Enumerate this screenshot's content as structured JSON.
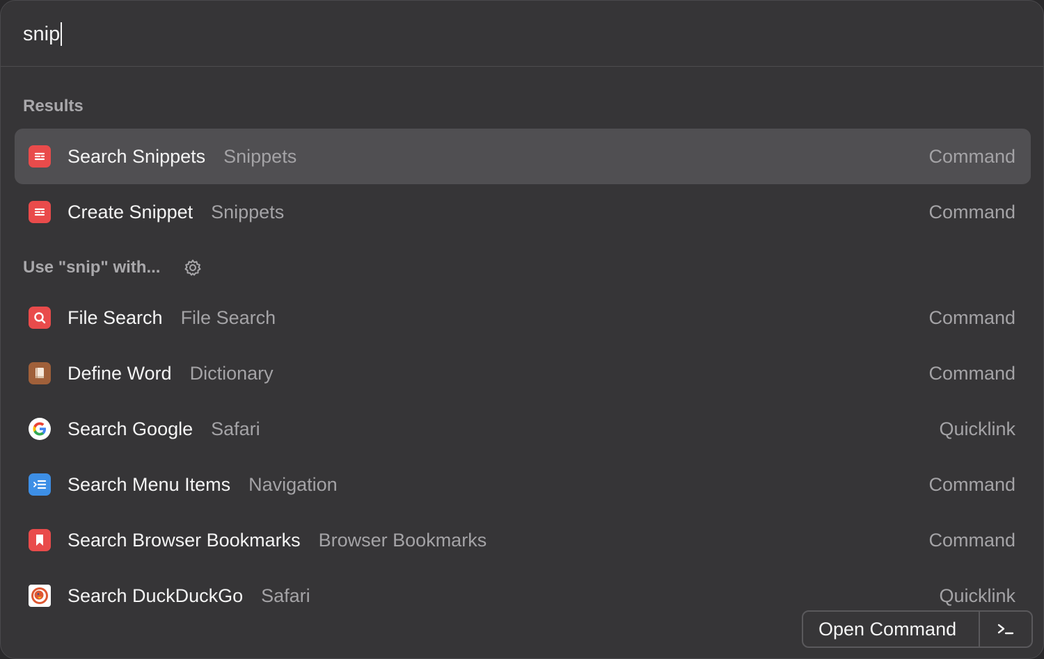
{
  "search": {
    "query": "snip"
  },
  "sections": {
    "results_header": "Results",
    "fallback_header": "Use \"snip\" with..."
  },
  "results": [
    {
      "title": "Search Snippets",
      "subtitle": "Snippets",
      "kind": "Command",
      "icon": "snippets-icon",
      "selected": true
    },
    {
      "title": "Create Snippet",
      "subtitle": "Snippets",
      "kind": "Command",
      "icon": "snippets-icon",
      "selected": false
    }
  ],
  "fallbacks": [
    {
      "title": "File Search",
      "subtitle": "File Search",
      "kind": "Command",
      "icon": "file-search-icon"
    },
    {
      "title": "Define Word",
      "subtitle": "Dictionary",
      "kind": "Command",
      "icon": "dictionary-icon"
    },
    {
      "title": "Search Google",
      "subtitle": "Safari",
      "kind": "Quicklink",
      "icon": "google-icon"
    },
    {
      "title": "Search Menu Items",
      "subtitle": "Navigation",
      "kind": "Command",
      "icon": "menu-items-icon"
    },
    {
      "title": "Search Browser Bookmarks",
      "subtitle": "Browser Bookmarks",
      "kind": "Command",
      "icon": "bookmark-icon"
    },
    {
      "title": "Search DuckDuckGo",
      "subtitle": "Safari",
      "kind": "Quicklink",
      "icon": "duckduckgo-icon"
    }
  ],
  "footer": {
    "action_label": "Open Command"
  },
  "colors": {
    "background": "#363537",
    "selected_row": "#504f52",
    "snippets_red": "#e94b4b",
    "menu_blue": "#3d8fe6",
    "dictionary_brown": "#a0603a"
  }
}
